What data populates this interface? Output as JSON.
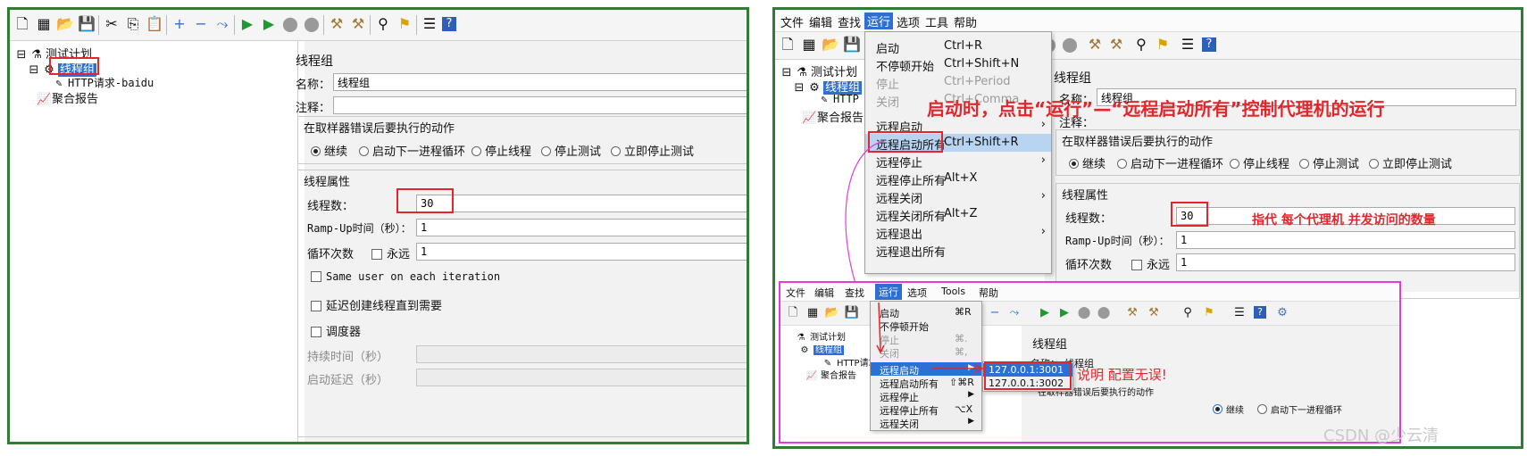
{
  "left": {
    "tree": {
      "root": "测试计划",
      "thread_group": "线程组",
      "http": "HTTP请求-baidu",
      "report": "聚合报告"
    },
    "form": {
      "title": "线程组",
      "name_label": "名称：",
      "name_value": "线程组",
      "comment_label": "注释：",
      "error_group_title": "在取样器错误后要执行的动作",
      "radios": [
        "继续",
        "启动下一进程循环",
        "停止线程",
        "停止测试",
        "立即停止测试"
      ],
      "props_title": "线程属性",
      "threads_label": "线程数：",
      "threads_value": "30",
      "rampup_label": "Ramp-Up时间（秒）：",
      "rampup_value": "1",
      "loop_label": "循环次数",
      "forever_label": "永远",
      "loop_value": "1",
      "same_user": "Same user on each iteration",
      "delay_create": "延迟创建线程直到需要",
      "scheduler": "调度器",
      "duration_label": "持续时间（秒）",
      "startup_delay_label": "启动延迟（秒）"
    }
  },
  "right": {
    "menubar": [
      "文件",
      "编辑",
      "查找",
      "运行",
      "选项",
      "工具",
      "帮助"
    ],
    "tree": {
      "root": "测试计划",
      "thread_group": "线程组",
      "http": "HTTP",
      "report": "聚合报告"
    },
    "run_menu": [
      {
        "label": "启动",
        "key": "Ctrl+R"
      },
      {
        "label": "不停顿开始",
        "key": "Ctrl+Shift+N"
      },
      {
        "label": "停止",
        "key": "Ctrl+Period"
      },
      {
        "label": "关闭",
        "key": "Ctrl+Comma"
      },
      {
        "label": "远程启动",
        "key": ""
      },
      {
        "label": "远程启动所有",
        "key": "Ctrl+Shift+R"
      },
      {
        "label": "远程停止",
        "key": ""
      },
      {
        "label": "远程停止所有",
        "key": "Alt+X"
      },
      {
        "label": "远程关闭",
        "key": ""
      },
      {
        "label": "远程关闭所有",
        "key": "Alt+Z"
      },
      {
        "label": "远程退出",
        "key": ""
      },
      {
        "label": "远程退出所有",
        "key": ""
      }
    ],
    "form": {
      "title": "线程组",
      "name_label": "名称：",
      "name_value": "线程组",
      "comment_label": "注释：",
      "error_group_title": "在取样器错误后要执行的动作",
      "radios": [
        "继续",
        "启动下一进程循环",
        "停止线程",
        "停止测试",
        "立即停止测试"
      ],
      "props_title": "线程属性",
      "threads_label": "线程数：",
      "threads_value": "30",
      "rampup_label": "Ramp-Up时间（秒）：",
      "rampup_value": "1",
      "loop_label": "循环次数",
      "forever_label": "永远",
      "loop_value": "1"
    },
    "annotation_main": "启动时，点击“运行”—“远程启动所有”控制代理机的运行",
    "annotation_threads": "指代 每个代理机 并发访问的数量"
  },
  "inset": {
    "menubar": [
      "文件",
      "编辑",
      "查找",
      "运行",
      "选项",
      "Tools",
      "帮助"
    ],
    "tree": {
      "root": "测试计划",
      "thread_group": "线程组",
      "http": "HTTP请求",
      "report": "聚合报告"
    },
    "run_menu": [
      {
        "label": "启动",
        "key": "⌘R"
      },
      {
        "label": "不停顿开始",
        "key": ""
      },
      {
        "label": "停止",
        "key": "⌘."
      },
      {
        "label": "关闭",
        "key": "⌘,"
      },
      {
        "label": "远程启动",
        "key": ""
      },
      {
        "label": "远程启动所有",
        "key": "⇧⌘R"
      },
      {
        "label": "远程停止",
        "key": ""
      },
      {
        "label": "远程停止所有",
        "key": "⌥X"
      },
      {
        "label": "远程关闭",
        "key": ""
      }
    ],
    "hosts": [
      "127.0.0.1:3001",
      "127.0.0.1:3002"
    ],
    "annotation": "说明 配置无误!",
    "form_title": "线程组",
    "name_label": "名称：",
    "name_value": "线程组",
    "error_group_title": "在取样器错误后要执行的动作",
    "radio_continue": "继续",
    "radio_next": "启动下一进程循环"
  },
  "watermark": "CSDN @少云清",
  "colors": {
    "frame_green": "#2f7d34",
    "annot_red": "#e3262b",
    "inset_magenta": "#e43bd9",
    "highlight_blue": "#2d6fd2"
  }
}
